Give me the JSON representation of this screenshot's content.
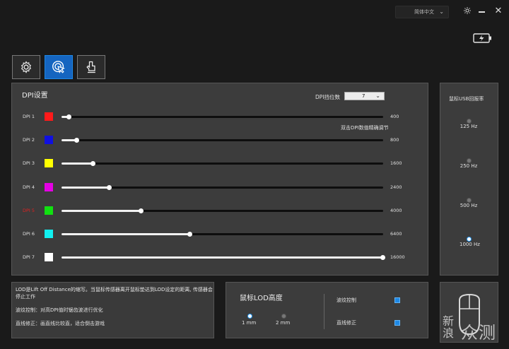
{
  "topbar": {
    "language": "简体中文"
  },
  "dpi_panel": {
    "title": "DPI设置",
    "levels_label": "DPI挡位数",
    "levels_value": "7",
    "hint": "双击DPI数值精确调节",
    "rows": [
      {
        "label": "DPI 1",
        "color": "#ff1a1a",
        "value": "400",
        "fraction": 0.025,
        "active": false
      },
      {
        "label": "DPI 2",
        "color": "#1010e0",
        "value": "800",
        "fraction": 0.05,
        "active": false
      },
      {
        "label": "DPI 3",
        "color": "#ffff00",
        "value": "1600",
        "fraction": 0.1,
        "active": false
      },
      {
        "label": "DPI 4",
        "color": "#e400e4",
        "value": "2400",
        "fraction": 0.15,
        "active": false
      },
      {
        "label": "DPI 5",
        "color": "#11e011",
        "value": "4000",
        "fraction": 0.25,
        "active": true
      },
      {
        "label": "DPI 6",
        "color": "#11f0f0",
        "value": "6400",
        "fraction": 0.4,
        "active": false
      },
      {
        "label": "DPI 7",
        "color": "#ffffff",
        "value": "16000",
        "fraction": 1.0,
        "active": false
      }
    ],
    "active_label_color": "#e02020"
  },
  "usb_panel": {
    "title": "鼠标USB回报率",
    "options": [
      {
        "label": "125 Hz",
        "selected": false
      },
      {
        "label": "250 Hz",
        "selected": false
      },
      {
        "label": "500 Hz",
        "selected": false
      },
      {
        "label": "1000 Hz",
        "selected": true
      }
    ]
  },
  "info_panel": {
    "line1": "LOD是Lift Off Distance的缩写。当鼠标传感器离开鼠标垫达到LOD设定的距离, 传感器会停止工作",
    "line2": "波纹控制：对高DPI值时锯齿波进行优化",
    "line3": "直线修正：画直线比较直，适合倒击游戏"
  },
  "lod_panel": {
    "title": "鼠标LOD高度",
    "options": [
      {
        "label": "1 mm",
        "selected": true
      },
      {
        "label": "2 mm",
        "selected": false
      }
    ],
    "toggles": [
      {
        "label": "波纹控制",
        "checked": true
      },
      {
        "label": "直线修正",
        "checked": true
      }
    ]
  },
  "watermark": {
    "line1": "新",
    "line2": "浪",
    "text": "众测"
  }
}
